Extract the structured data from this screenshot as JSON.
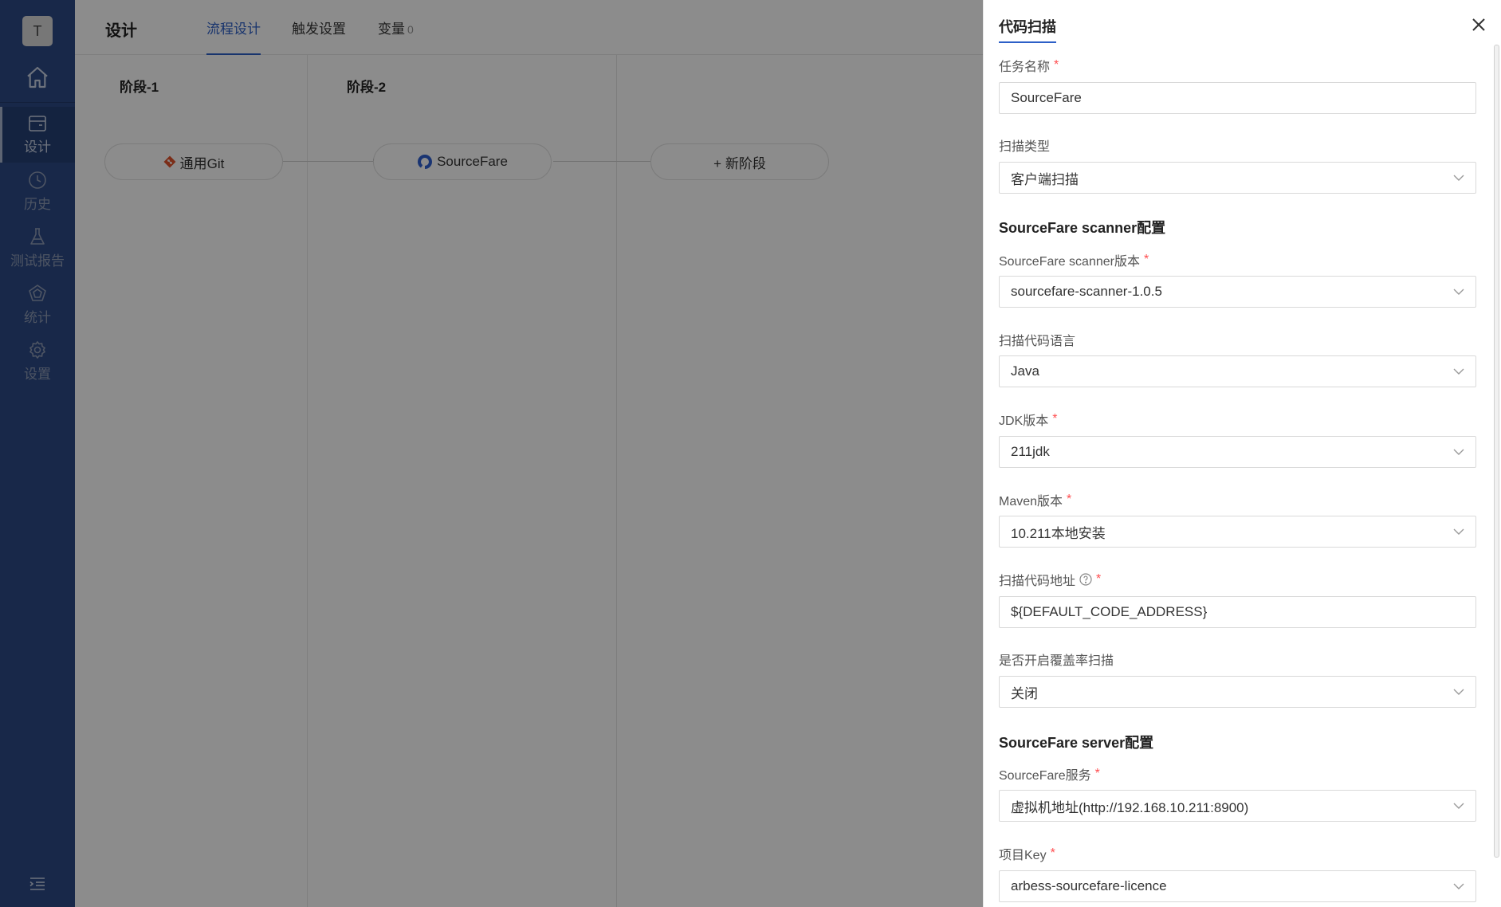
{
  "sidebar": {
    "avatar": "T",
    "items": [
      {
        "label": "设计",
        "icon": "design-icon"
      },
      {
        "label": "历史",
        "icon": "history-icon"
      },
      {
        "label": "测试报告",
        "icon": "flask-icon"
      },
      {
        "label": "统计",
        "icon": "statistics-icon"
      },
      {
        "label": "设置",
        "icon": "gear-icon"
      }
    ]
  },
  "header": {
    "title": "设计",
    "tabs": [
      {
        "label": "流程设计"
      },
      {
        "label": "触发设置"
      },
      {
        "label": "变量",
        "count": "0"
      }
    ]
  },
  "pipeline": {
    "stages": [
      {
        "title": "阶段-1",
        "task": "通用Git"
      },
      {
        "title": "阶段-2",
        "task": "SourceFare"
      }
    ],
    "new_stage": "+ 新阶段"
  },
  "drawer": {
    "title": "代码扫描",
    "task_name_label": "任务名称",
    "task_name_value": "SourceFare",
    "scan_type_label": "扫描类型",
    "scan_type_value": "客户端扫描",
    "scanner_section": "SourceFare scanner配置",
    "scanner_version_label": "SourceFare scanner版本",
    "scanner_version_value": "sourcefare-scanner-1.0.5",
    "language_label": "扫描代码语言",
    "language_value": "Java",
    "jdk_label": "JDK版本",
    "jdk_value": "211jdk",
    "maven_label": "Maven版本",
    "maven_value": "10.211本地安装",
    "address_label": "扫描代码地址",
    "address_value": "${DEFAULT_CODE_ADDRESS}",
    "coverage_label": "是否开启覆盖率扫描",
    "coverage_value": "关闭",
    "server_section": "SourceFare server配置",
    "service_label": "SourceFare服务",
    "service_value": "虚拟机地址(http://192.168.10.211:8900)",
    "project_key_label": "项目Key",
    "project_key_value": "arbess-sourcefare-licence",
    "required_mark": "*"
  },
  "colors": {
    "sidebar": "#2c4a86",
    "accent": "#2d5fc7",
    "required": "#ff4d4f"
  }
}
